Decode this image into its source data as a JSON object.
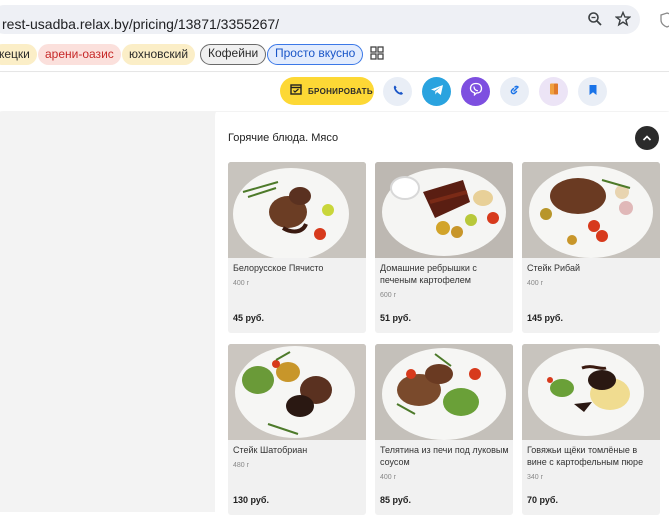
{
  "browser": {
    "url": "rest-usadba.relax.by/pricing/13871/3355267/"
  },
  "bookmarks": [
    {
      "label": "кецки"
    },
    {
      "label": "арени-оазис"
    },
    {
      "label": "юхновский"
    },
    {
      "label": "Кофейни"
    },
    {
      "label": "Просто вкусно"
    }
  ],
  "header": {
    "book_label": "БРОНИРОВАТЬ"
  },
  "section": {
    "title": "Горячие блюда. Мясо"
  },
  "dishes": [
    {
      "name": "Белорусское Пячисто",
      "weight": "400 г",
      "price": "45 руб."
    },
    {
      "name": "Домашние ребрышки с печеным картофелем",
      "weight": "600 г",
      "price": "51 руб."
    },
    {
      "name": "Стейк Рибай",
      "weight": "400 г",
      "price": "145 руб."
    },
    {
      "name": "Стейк Шатобриан",
      "weight": "480 г",
      "price": "130 руб."
    },
    {
      "name": "Телятина из печи под луковым соусом",
      "weight": "400 г",
      "price": "85 руб."
    },
    {
      "name": "Говяжьи щёки томлёные в вине с картофельным пюре",
      "weight": "340 г",
      "price": "70 руб."
    }
  ],
  "colors": {
    "book_button": "#fdd835",
    "telegram": "#2aa3df",
    "viber": "#7d4fe0"
  }
}
